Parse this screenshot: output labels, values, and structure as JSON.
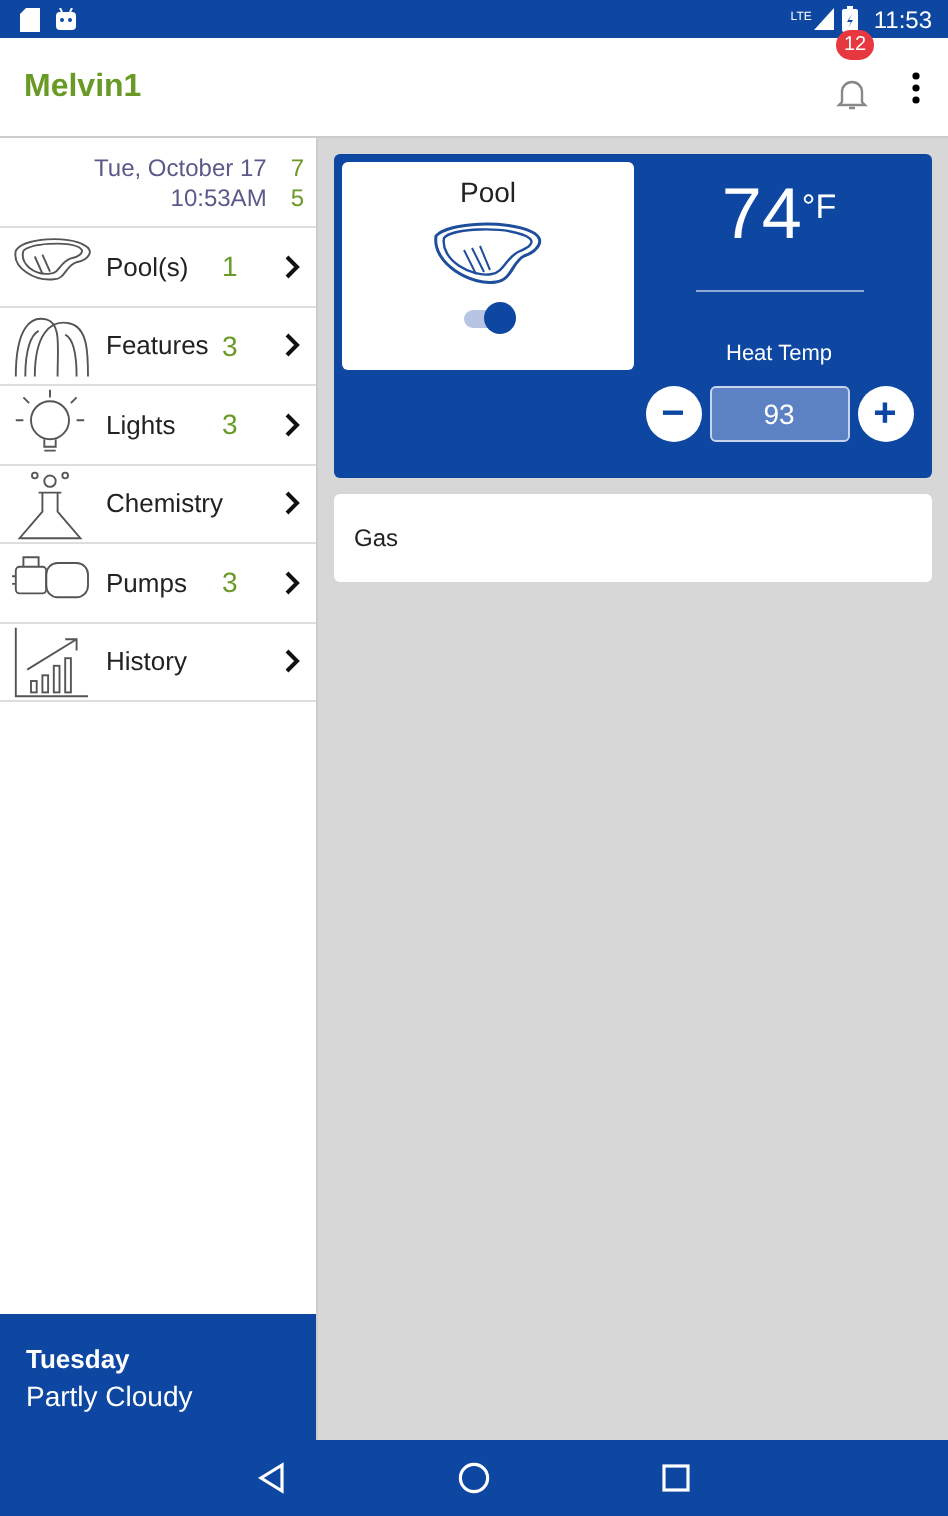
{
  "status_bar": {
    "network": "LTE",
    "time": "11:53"
  },
  "app_bar": {
    "title": "Melvin1",
    "notification_count": "12"
  },
  "sidebar": {
    "date": "Tue, October 17",
    "time": "10:53AM",
    "date_count": "7",
    "time_count": "5",
    "items": [
      {
        "kind": "pool",
        "label": "Pool(s)",
        "count": "1"
      },
      {
        "kind": "features",
        "label": "Features",
        "count": "3"
      },
      {
        "kind": "lights",
        "label": "Lights",
        "count": "3"
      },
      {
        "kind": "chemistry",
        "label": "Chemistry"
      },
      {
        "kind": "pumps",
        "label": "Pumps",
        "count": "3"
      },
      {
        "kind": "history",
        "label": "History"
      }
    ],
    "weather": {
      "day": "Tuesday",
      "condition": "Partly Cloudy"
    }
  },
  "body_card": {
    "name": "Pool",
    "on": true,
    "temperature": "74",
    "unit": "°F",
    "setpoint_label": "Heat Temp",
    "setpoint": "93",
    "minus": "−",
    "plus": "+"
  },
  "heater": {
    "label": "Gas"
  }
}
